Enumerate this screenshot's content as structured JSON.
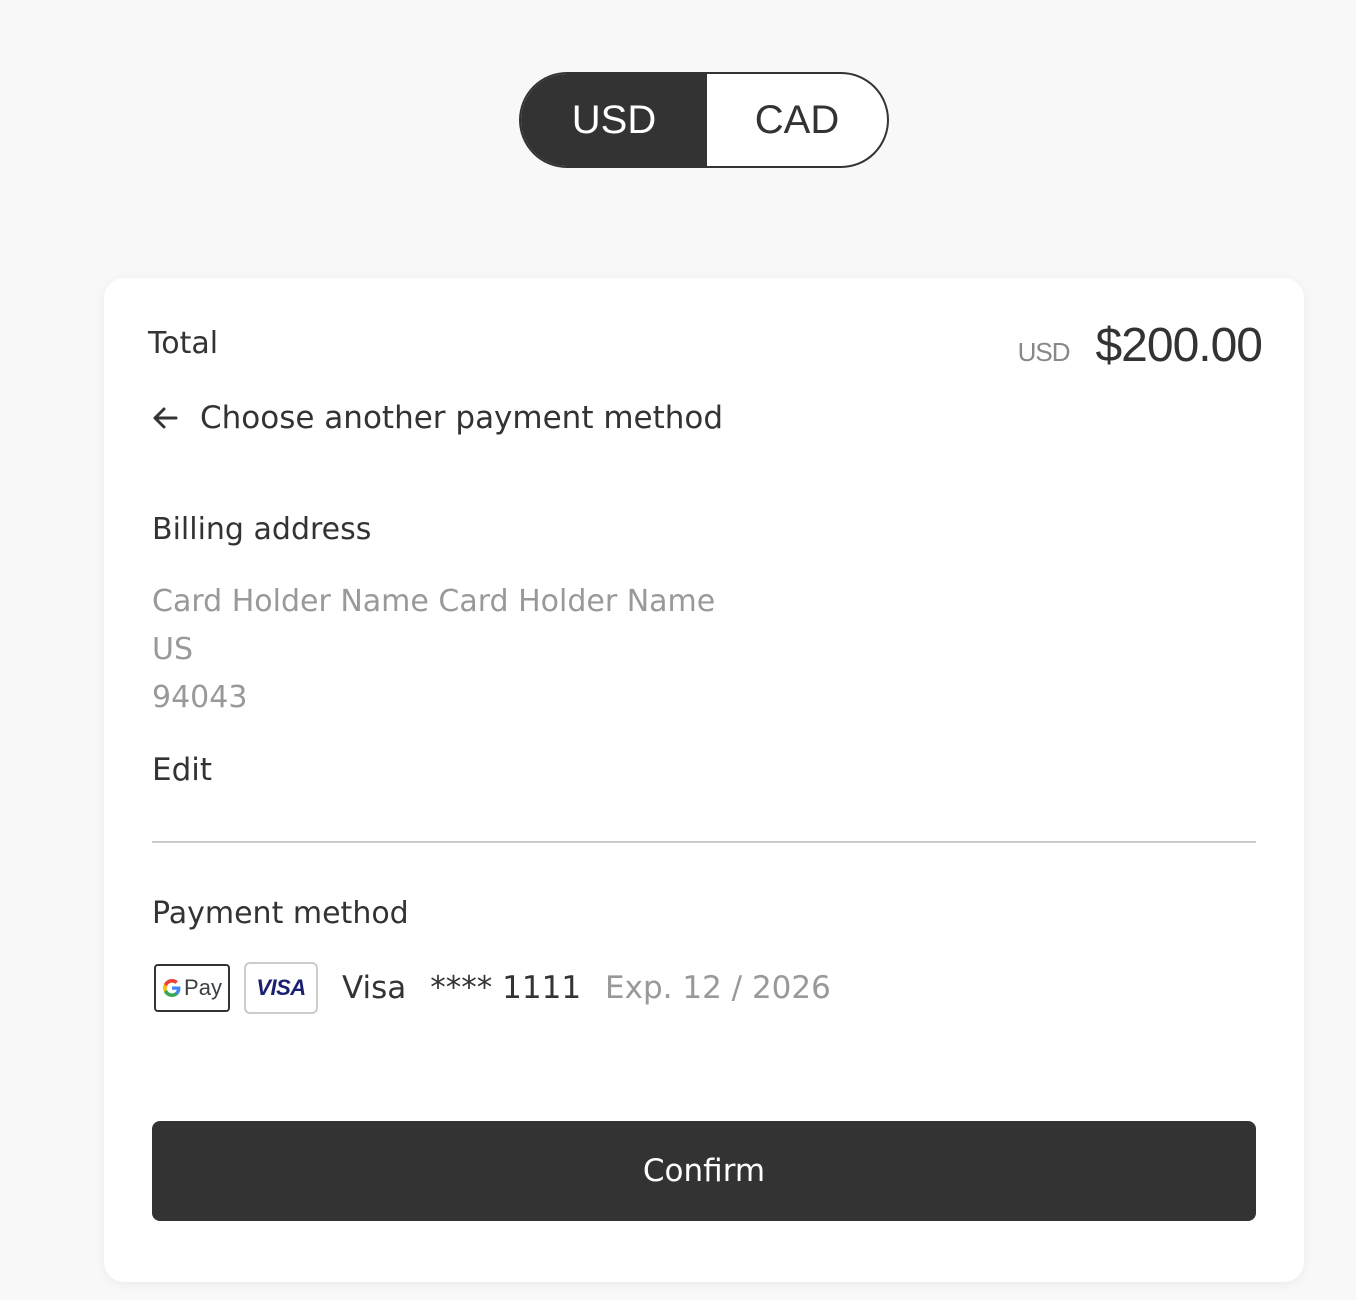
{
  "currency_toggle": {
    "options": [
      "USD",
      "CAD"
    ],
    "selected": "USD"
  },
  "summary": {
    "total_label": "Total",
    "currency": "USD",
    "amount": "$200.00"
  },
  "back_link": {
    "label": "Choose another payment method",
    "icon": "arrow-left-icon"
  },
  "billing": {
    "title": "Billing address",
    "lines": [
      "Card Holder Name Card Holder Name",
      "US",
      "94043"
    ],
    "edit_label": "Edit"
  },
  "payment": {
    "title": "Payment method",
    "wallet_badge": {
      "icon": "google-pay-icon",
      "text": "Pay"
    },
    "card_badge": {
      "icon": "visa-icon",
      "text": "VISA"
    },
    "brand": "Visa",
    "number": "**** 1111",
    "expiry": "Exp. 12 / 2026"
  },
  "confirm_label": "Confirm",
  "colors": {
    "primary": "#333333",
    "muted": "#999999",
    "background": "#f8f8f8",
    "visa_blue": "#1a1f71"
  }
}
